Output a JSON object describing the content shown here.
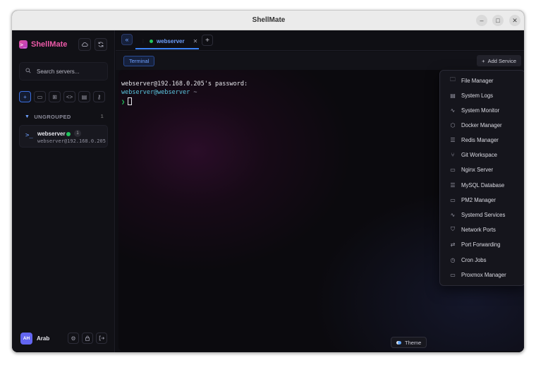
{
  "window": {
    "title": "ShellMate",
    "controls": {
      "minimize": "–",
      "maximize": "□",
      "close": "✕"
    }
  },
  "sidebar": {
    "brand": "ShellMate",
    "brand_icon": "terminal-logo-icon",
    "search": {
      "placeholder": "Search servers..."
    },
    "group": {
      "label": "UNGROUPED",
      "count": "1"
    },
    "servers": [
      {
        "name": "webserver",
        "address": "webserver@192.168.0.205",
        "status": "online",
        "badge": "1"
      }
    ],
    "user": {
      "initials": "AH",
      "name": "Arab"
    }
  },
  "tabs": [
    {
      "label": "webserver",
      "status": "online",
      "active": true
    }
  ],
  "subbar": {
    "terminal_tab": "Terminal",
    "add_service_label": "Add Service"
  },
  "terminal": {
    "lines": [
      "webserver@192.168.0.205's password:"
    ],
    "prompt_user": "webserver@webserver",
    "prompt_path": "~",
    "prompt_arrow": "❯"
  },
  "theme_button": "Theme",
  "service_menu": [
    {
      "label": "File Manager",
      "icon": "folder-icon"
    },
    {
      "label": "System Logs",
      "icon": "file-text-icon"
    },
    {
      "label": "System Monitor",
      "icon": "activity-icon"
    },
    {
      "label": "Docker Manager",
      "icon": "box-icon"
    },
    {
      "label": "Redis Manager",
      "icon": "database-icon"
    },
    {
      "label": "Git Workspace",
      "icon": "git-branch-icon"
    },
    {
      "label": "Nginx Server",
      "icon": "server-icon"
    },
    {
      "label": "MySQL Database",
      "icon": "database-icon"
    },
    {
      "label": "PM2 Manager",
      "icon": "server-icon"
    },
    {
      "label": "Systemd Services",
      "icon": "activity-icon"
    },
    {
      "label": "Network Ports",
      "icon": "shield-icon"
    },
    {
      "label": "Port Forwarding",
      "icon": "repeat-icon"
    },
    {
      "label": "Cron Jobs",
      "icon": "clock-icon"
    },
    {
      "label": "Proxmox Manager",
      "icon": "server-icon"
    }
  ],
  "colors": {
    "accent": "#3b82f6",
    "brand": "#ec5aa8",
    "online": "#22c55e",
    "prompt": "#5cc6e0"
  }
}
